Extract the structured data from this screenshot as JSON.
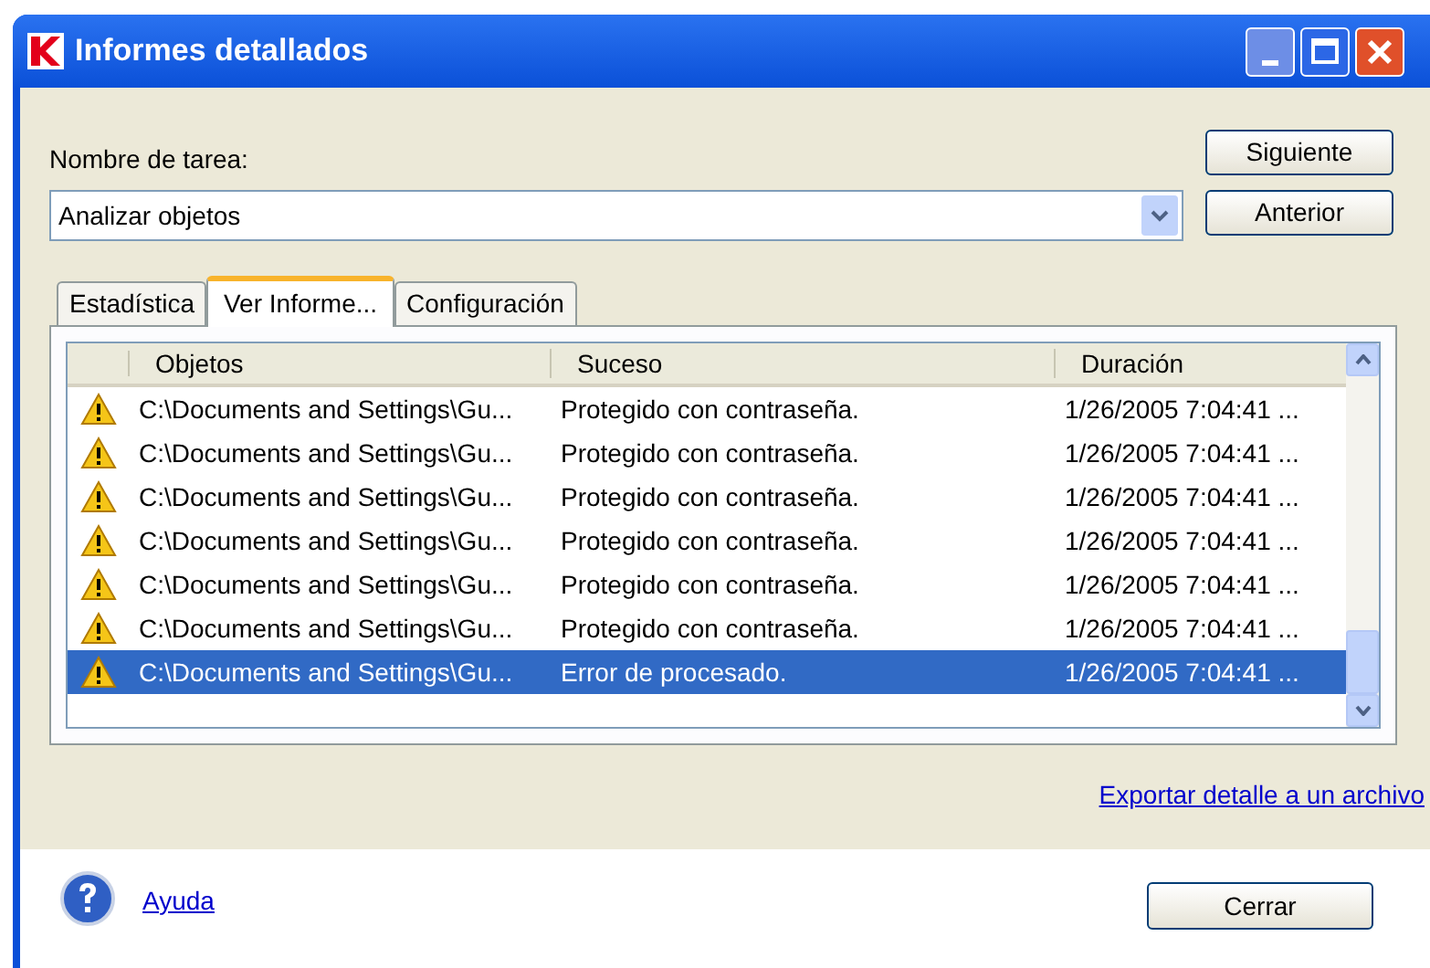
{
  "window": {
    "title": "Informes detallados"
  },
  "task": {
    "label": "Nombre de tarea:",
    "value": "Analizar objetos"
  },
  "buttons": {
    "next": "Siguiente",
    "previous": "Anterior",
    "close": "Cerrar"
  },
  "tabs": [
    {
      "label": "Estadística",
      "selected": false
    },
    {
      "label": "Ver Informe...",
      "selected": true
    },
    {
      "label": "Configuración",
      "selected": false
    }
  ],
  "table": {
    "columns": [
      "Objetos",
      "Suceso",
      "Duración"
    ],
    "rows": [
      {
        "object": "C:\\Documents and Settings\\Gu...",
        "event": "Protegido con contraseña.",
        "duration": "1/26/2005 7:04:41 ...",
        "selected": false
      },
      {
        "object": "C:\\Documents and Settings\\Gu...",
        "event": "Protegido con contraseña.",
        "duration": "1/26/2005 7:04:41 ...",
        "selected": false
      },
      {
        "object": "C:\\Documents and Settings\\Gu...",
        "event": "Protegido con contraseña.",
        "duration": "1/26/2005 7:04:41 ...",
        "selected": false
      },
      {
        "object": "C:\\Documents and Settings\\Gu...",
        "event": "Protegido con contraseña.",
        "duration": "1/26/2005 7:04:41 ...",
        "selected": false
      },
      {
        "object": "C:\\Documents and Settings\\Gu...",
        "event": "Protegido con contraseña.",
        "duration": "1/26/2005 7:04:41 ...",
        "selected": false
      },
      {
        "object": "C:\\Documents and Settings\\Gu...",
        "event": "Protegido con contraseña.",
        "duration": "1/26/2005 7:04:41 ...",
        "selected": false
      },
      {
        "object": "C:\\Documents and Settings\\Gu...",
        "event": "Error de procesado.",
        "duration": "1/26/2005 7:04:41 ...",
        "selected": true
      }
    ]
  },
  "export_link": "Exportar detalle a un archivo",
  "help_link": "Ayuda"
}
